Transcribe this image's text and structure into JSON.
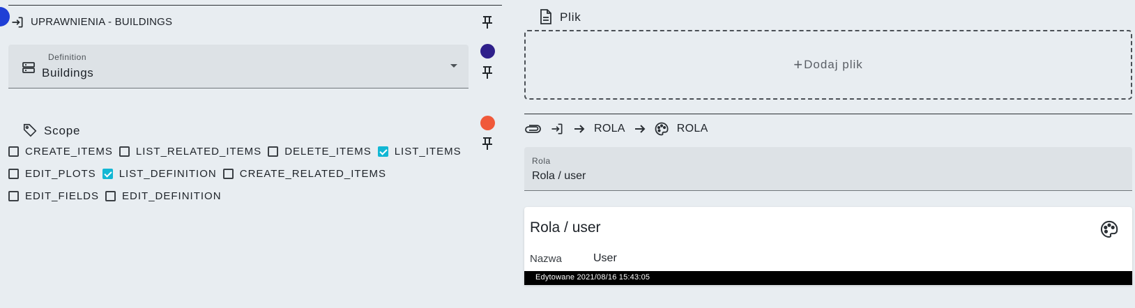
{
  "permissions": {
    "title": "UPRAWNIENIA - BUILDINGS",
    "definition": {
      "label": "Definition",
      "value": "Buildings"
    },
    "scope": {
      "title": "Scope",
      "rows": [
        [
          {
            "label": "CREATE_ITEMS",
            "checked": false
          },
          {
            "label": "LIST_RELATED_ITEMS",
            "checked": false
          },
          {
            "label": "DELETE_ITEMS",
            "checked": false
          },
          {
            "label": "LIST_ITEMS",
            "checked": true
          }
        ],
        [
          {
            "label": "EDIT_PLOTS",
            "checked": false
          },
          {
            "label": "LIST_DEFINITION",
            "checked": true
          },
          {
            "label": "CREATE_RELATED_ITEMS",
            "checked": false
          }
        ],
        [
          {
            "label": "EDIT_FIELDS",
            "checked": false
          },
          {
            "label": "EDIT_DEFINITION",
            "checked": false
          }
        ]
      ]
    }
  },
  "file": {
    "title": "Plik",
    "add_label": "Dodaj plik"
  },
  "relation": {
    "path": [
      "ROLA",
      "ROLA"
    ],
    "field": {
      "label": "Rola",
      "value": "Rola / user"
    },
    "card": {
      "title": "Rola / user",
      "field_key": "Nazwa",
      "field_value": "User",
      "footer": "Edytowane 2021/08/16 15:43:05"
    }
  },
  "colors": {
    "accent_blue": "#1f3fd6",
    "navy_dot": "#2e1f8a",
    "orange_dot": "#f0593a",
    "checkbox_checked": "#12b7d4"
  },
  "icons": [
    "login-icon",
    "pin-icon",
    "storage-icon",
    "tag-icon",
    "document-icon",
    "attachment-icon",
    "arrow-right-icon",
    "palette-icon"
  ]
}
